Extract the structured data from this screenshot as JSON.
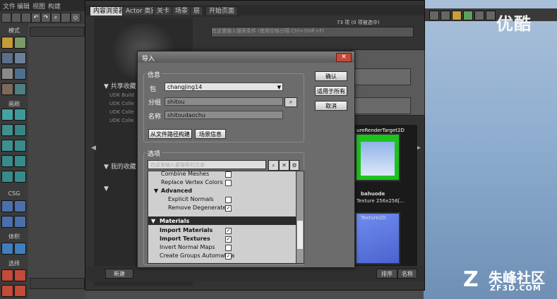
{
  "menubar": {
    "items": [
      "文件",
      "编辑",
      "视图",
      "构建"
    ]
  },
  "left_panel": {
    "mode_label": "模式",
    "brush_label": "画刷",
    "csg_label": "CSG",
    "volume_label": "体积",
    "select_label": "选择"
  },
  "content_browser": {
    "tabs": [
      "内容浏览器",
      "Actor 类别",
      "关卡",
      "场景",
      "层",
      "开始页面"
    ],
    "count_text": "73 项 (0 项被选中)",
    "search_placeholder": "在这里输入搜索条件 (使用空格分隔 Ctrl+Shift+F)",
    "shared_collections": "共享收藏",
    "my_collections": "我的收藏",
    "tree_items": [
      "UDK Build",
      "UDK Colle",
      "UDK Colle",
      "UDK Colle"
    ],
    "thumbnails": [
      {
        "name": "bahuode",
        "info": "Texture 256x256[...",
        "top_label": "ureRenderTarget2D"
      },
      {
        "name": "Texture2D",
        "info": "",
        "top_label": ""
      }
    ],
    "bottom_buttons": [
      "新建",
      "排序",
      "名称"
    ]
  },
  "import_dialog": {
    "title": "导入",
    "close": "✕",
    "info_group": "信息",
    "package_label": "包",
    "package_value": "changjing14",
    "group_label": "分组",
    "group_value": "shitou",
    "name_label": "名称",
    "name_value": "shitoudaochu",
    "build_from_path_button": "从文件路径构建",
    "scene_info_button": "场景信息",
    "ok_button": "确认",
    "apply_all_button": "适用于所有",
    "cancel_button": "取消",
    "options_group": "选项",
    "options_search_placeholder": "在这里输入要搜索的文本",
    "options": [
      {
        "label": "Combine Meshes",
        "checked": false,
        "bold": false
      },
      {
        "label": "Replace Vertex Colors",
        "checked": false,
        "bold": false
      },
      {
        "label": "Advanced",
        "category": true
      },
      {
        "label": "Explicit Normals",
        "checked": false,
        "bold": false
      },
      {
        "label": "Remove Degenerates",
        "checked": true,
        "bold": false
      },
      {
        "label": "Materials",
        "category_dark": true
      },
      {
        "label": "Import Materials",
        "checked": true,
        "bold": true
      },
      {
        "label": "Import Textures",
        "checked": true,
        "bold": true
      },
      {
        "label": "Invert Normal Maps",
        "checked": false,
        "bold": false
      },
      {
        "label": "Create Groups Automatica",
        "checked": true,
        "bold": false
      }
    ]
  },
  "watermarks": {
    "top": "优酷",
    "bottom_name": "朱峰社区",
    "bottom_url": "ZF3D.COM",
    "bottom_logo": "Z"
  }
}
